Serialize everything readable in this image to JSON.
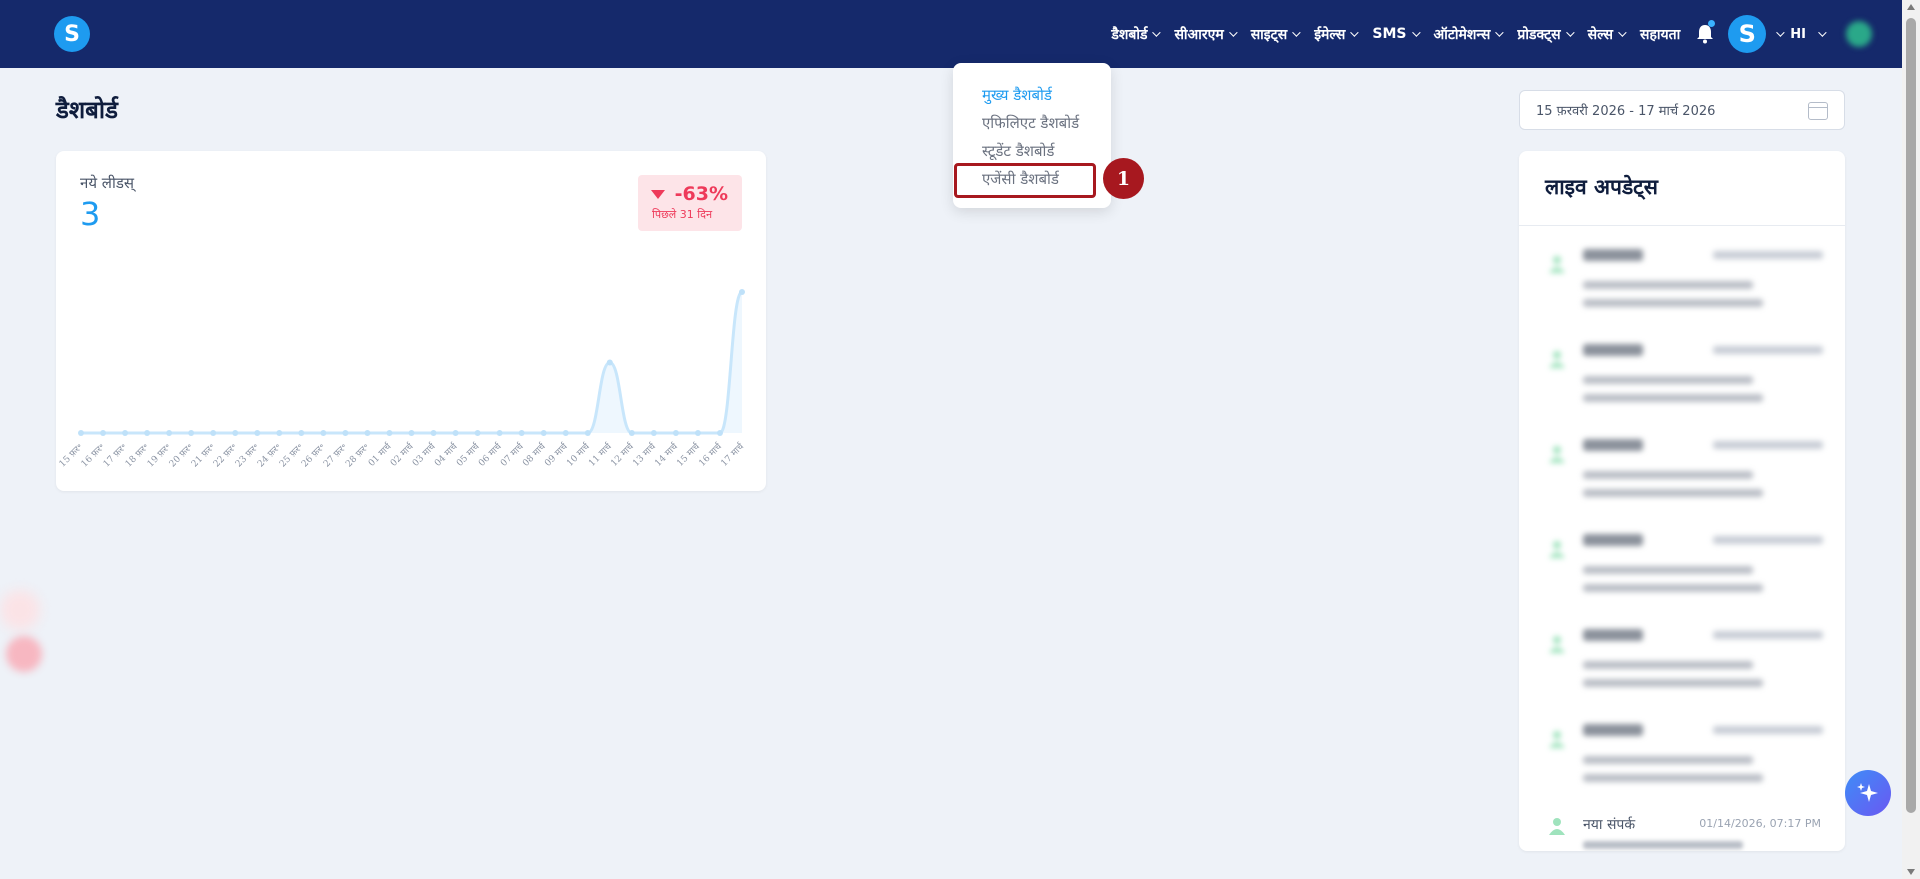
{
  "brand": {
    "letter": "S"
  },
  "nav": {
    "items": [
      {
        "label": "डैशबोर्ड",
        "has_chevron": true
      },
      {
        "label": "सीआरएम",
        "has_chevron": true
      },
      {
        "label": "साइट्स",
        "has_chevron": true
      },
      {
        "label": "ईमेल्स",
        "has_chevron": true
      },
      {
        "label": "SMS",
        "has_chevron": true
      },
      {
        "label": "ऑटोमेशन्स",
        "has_chevron": true
      },
      {
        "label": "प्रोडक्ट्स",
        "has_chevron": true
      },
      {
        "label": "सेल्स",
        "has_chevron": true
      },
      {
        "label": "सहायता",
        "has_chevron": false
      }
    ],
    "avatar_letter": "S",
    "language": "HI"
  },
  "page": {
    "title": "डैशबोर्ड"
  },
  "date_range": {
    "value": "15 फ़रवरी 2026 - 17 मार्च 2026"
  },
  "dropdown": {
    "items": [
      {
        "label": "मुख्य डैशबोर्ड",
        "active": true
      },
      {
        "label": "एफिलिएट डैशबोर्ड",
        "active": false
      },
      {
        "label": "स्टूडेंट डैशबोर्ड",
        "active": false
      },
      {
        "label": "एजेंसी डैशबोर्ड",
        "active": false
      }
    ],
    "step_number": "1"
  },
  "stat_card": {
    "label": "नये लीडस्",
    "value": "3",
    "change": "-63%",
    "change_sub": "पिछले 31 दिन"
  },
  "chart_data": {
    "type": "area",
    "x": [
      "15 फ़र॰",
      "16 फ़र॰",
      "17 फ़र॰",
      "18 फ़र॰",
      "19 फ़र॰",
      "20 फ़र॰",
      "21 फ़र॰",
      "22 फ़र॰",
      "23 फ़र॰",
      "24 फ़र॰",
      "25 फ़र॰",
      "26 फ़र॰",
      "27 फ़र॰",
      "28 फ़र॰",
      "01 मार्च",
      "02 मार्च",
      "03 मार्च",
      "04 मार्च",
      "05 मार्च",
      "06 मार्च",
      "07 मार्च",
      "08 मार्च",
      "09 मार्च",
      "10 मार्च",
      "11 मार्च",
      "12 मार्च",
      "13 मार्च",
      "14 मार्च",
      "15 मार्च",
      "16 मार्च",
      "17 मार्च"
    ],
    "values": [
      0,
      0,
      0,
      0,
      0,
      0,
      0,
      0,
      0,
      0,
      0,
      0,
      0,
      0,
      0,
      0,
      0,
      0,
      0,
      0,
      0,
      0,
      0,
      0,
      1,
      0,
      0,
      0,
      0,
      0,
      2
    ],
    "ylim": [
      0,
      2
    ],
    "color": "#c8e6fb",
    "point_color": "#bfe1f9"
  },
  "live_updates": {
    "title": "लाइव अपडेट्स",
    "last_item": {
      "name": "नया संपर्क",
      "time": "01/14/2026, 07:17 PM"
    }
  },
  "colors": {
    "navbar": "#15296b",
    "accent": "#1e9bf0",
    "negative": "#ee3a5a",
    "highlight": "#a7181f"
  }
}
